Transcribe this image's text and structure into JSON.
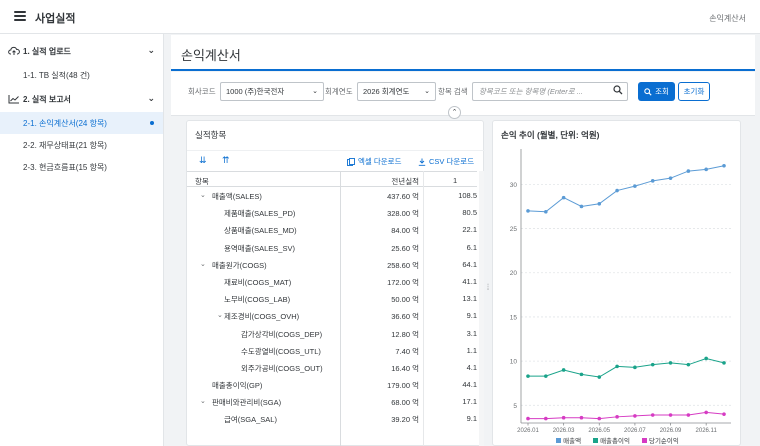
{
  "shell": {
    "title": "사업실적",
    "right_label": "손익계산서"
  },
  "sidebar": {
    "groups": [
      {
        "label": "1. 실적 업로드",
        "items": [
          {
            "label": "1-1. TB 실적(48 건)"
          }
        ]
      },
      {
        "label": "2. 실적 보고서",
        "items": [
          {
            "label": "2-1. 손익계산서(24 항목)",
            "active": true
          },
          {
            "label": "2-2. 재무상태표(21 항목)"
          },
          {
            "label": "2-3. 현금흐름표(15 항목)"
          }
        ]
      }
    ]
  },
  "page": {
    "title": "손익계산서"
  },
  "filters": {
    "company_label": "회사코드",
    "company_value": "1000 (주)한국전자",
    "year_label": "회계연도",
    "year_value": "2026 회계연도",
    "search_label": "항목 검색",
    "search_placeholder": "항목코드 또는 항목명 (Enter로 ...",
    "search_button": "조회",
    "reset_button": "초기화"
  },
  "table": {
    "title": "실적항목",
    "excel_download": "엑셀 다운로드",
    "csv_download": "CSV 다운로드",
    "col_item": "항목",
    "col_prev": "전년실적",
    "col_cur": "1",
    "rows": [
      {
        "level": 0,
        "toggle": "⌄",
        "name": "매출액(SALES)",
        "prev": "437.60 억",
        "cur": "108.5"
      },
      {
        "level": 1,
        "toggle": "",
        "name": "제품매출(SALES_PD)",
        "prev": "328.00 억",
        "cur": "80.5"
      },
      {
        "level": 1,
        "toggle": "",
        "name": "상품매출(SALES_MD)",
        "prev": "84.00 억",
        "cur": "22.1"
      },
      {
        "level": 1,
        "toggle": "",
        "name": "용역매출(SALES_SV)",
        "prev": "25.60 억",
        "cur": "6.1"
      },
      {
        "level": 0,
        "toggle": "⌄",
        "name": "매출원가(COGS)",
        "prev": "258.60 억",
        "cur": "64.1"
      },
      {
        "level": 1,
        "toggle": "",
        "name": "재료비(COGS_MAT)",
        "prev": "172.00 억",
        "cur": "41.1"
      },
      {
        "level": 1,
        "toggle": "",
        "name": "노무비(COGS_LAB)",
        "prev": "50.00 억",
        "cur": "13.1"
      },
      {
        "level": 1,
        "toggle": "⌄",
        "name": "제조경비(COGS_OVH)",
        "prev": "36.60 억",
        "cur": "9.1"
      },
      {
        "level": 2,
        "toggle": "",
        "name": "감가상각비(COGS_DEP)",
        "prev": "12.80 억",
        "cur": "3.1"
      },
      {
        "level": 2,
        "toggle": "",
        "name": "수도광열비(COGS_UTL)",
        "prev": "7.40 억",
        "cur": "1.1"
      },
      {
        "level": 2,
        "toggle": "",
        "name": "외주가공비(COGS_OUT)",
        "prev": "16.40 억",
        "cur": "4.1"
      },
      {
        "level": 0,
        "toggle": "",
        "name": "매출총이익(GP)",
        "prev": "179.00 억",
        "cur": "44.1"
      },
      {
        "level": 0,
        "toggle": "⌄",
        "name": "판매비와관리비(SGA)",
        "prev": "68.00 억",
        "cur": "17.1"
      },
      {
        "level": 1,
        "toggle": "",
        "name": "급여(SGA_SAL)",
        "prev": "39.20 억",
        "cur": "9.1"
      }
    ]
  },
  "chart_data": {
    "type": "line",
    "title": "손익 추이 (월별, 단위: 억원)",
    "xlabel": "",
    "ylabel": "",
    "x": [
      "2026.01",
      "2026.02",
      "2026.03",
      "2026.04",
      "2026.05",
      "2026.06",
      "2026.07",
      "2026.08",
      "2026.09",
      "2026.10",
      "2026.11",
      "2026.12"
    ],
    "x_tick_labels": [
      "2026.01",
      "2026.03",
      "2026.05",
      "2026.07",
      "2026.09",
      "2026.11"
    ],
    "ylim": [
      3,
      34
    ],
    "yticks": [
      5,
      10,
      15,
      20,
      25,
      30
    ],
    "grid": true,
    "legend": "bottom",
    "series": [
      {
        "name": "매출액",
        "color": "#5b9bd5",
        "values": [
          27.0,
          26.9,
          28.5,
          27.5,
          27.8,
          29.3,
          29.8,
          30.4,
          30.7,
          31.5,
          31.7,
          32.1
        ]
      },
      {
        "name": "매출총이익",
        "color": "#1aa38a",
        "values": [
          8.3,
          8.3,
          9.0,
          8.5,
          8.2,
          9.4,
          9.3,
          9.6,
          9.8,
          9.6,
          10.3,
          9.8
        ]
      },
      {
        "name": "당기순이익",
        "color": "#d63bc3",
        "values": [
          3.5,
          3.5,
          3.6,
          3.6,
          3.5,
          3.7,
          3.8,
          3.9,
          3.9,
          3.9,
          4.2,
          4.0
        ]
      }
    ]
  }
}
